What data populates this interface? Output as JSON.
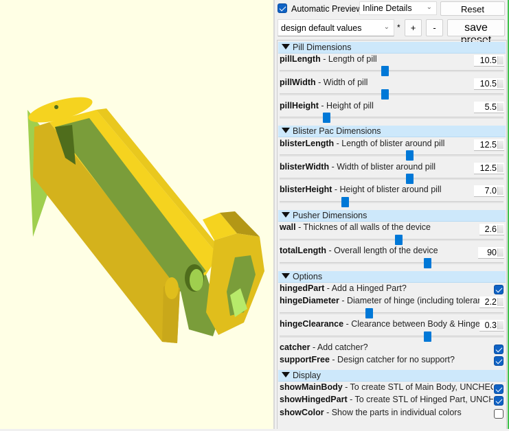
{
  "toolbar": {
    "auto_preview_label": "Automatic Preview",
    "auto_preview_checked": true,
    "view_mode": "Inline Details",
    "reset_label": "Reset"
  },
  "preset": {
    "selected": "design default values",
    "modified_marker": "*",
    "add_label": "+",
    "remove_label": "-",
    "save_label": "save preset"
  },
  "sections": [
    {
      "title": "Pill Dimensions",
      "params": [
        {
          "name": "pillLength",
          "desc": " - Length of pill",
          "value": "10.5",
          "slider": 0.47
        },
        {
          "name": "pillWidth",
          "desc": " - Width of pill",
          "value": "10.5",
          "slider": 0.47
        },
        {
          "name": "pillHeight",
          "desc": " - Height of pill",
          "value": "5.5",
          "slider": 0.21
        }
      ]
    },
    {
      "title": "Blister Pac Dimensions",
      "params": [
        {
          "name": "blisterLength",
          "desc": " - Length of blister around pill",
          "value": "12.5",
          "slider": 0.58
        },
        {
          "name": "blisterWidth",
          "desc": " - Width of blister around pill",
          "value": "12.5",
          "slider": 0.58
        },
        {
          "name": "blisterHeight",
          "desc": " - Height of blister around pill",
          "value": "7.0",
          "slider": 0.29
        }
      ]
    },
    {
      "title": "Pusher Dimensions",
      "params": [
        {
          "name": "wall",
          "desc": " - Thicknes of all walls of the device",
          "value": "2.6",
          "slider": 0.53
        },
        {
          "name": "totalLength",
          "desc": " - Overall length of the device",
          "value": "90",
          "slider": 0.66
        }
      ]
    },
    {
      "title": "Options",
      "params": [
        {
          "name": "hingedPart",
          "desc": " - Add a Hinged Part?",
          "checked": true
        },
        {
          "name": "hingeDiameter",
          "desc": " - Diameter of hinge (including tolerance)",
          "value": "2.2",
          "slider": 0.4
        },
        {
          "name": "hingeClearance",
          "desc": " - Clearance between Body & Hinged Par",
          "value": "0.3",
          "slider": 0.66
        },
        {
          "name": "catcher",
          "desc": " - Add catcher?",
          "checked": true
        },
        {
          "name": "supportFree",
          "desc": " - Design catcher for no support?",
          "checked": true
        }
      ]
    },
    {
      "title": "Display",
      "params": [
        {
          "name": "showMainBody",
          "desc": " - To create STL of Main Body, UNCHECK oth",
          "checked": true
        },
        {
          "name": "showHingedPart",
          "desc": " - To create STL of Hinged Part, UNCHECK",
          "checked": true
        },
        {
          "name": "showColor",
          "desc": " - Show the parts in individual colors",
          "checked": false
        }
      ]
    }
  ],
  "colors": {
    "viewport_bg": "#ffffe5",
    "model_face": "#f5d31f",
    "model_inner": "#7a9d3a",
    "accent": "#0078d7",
    "section_bg": "#cde8fb"
  }
}
